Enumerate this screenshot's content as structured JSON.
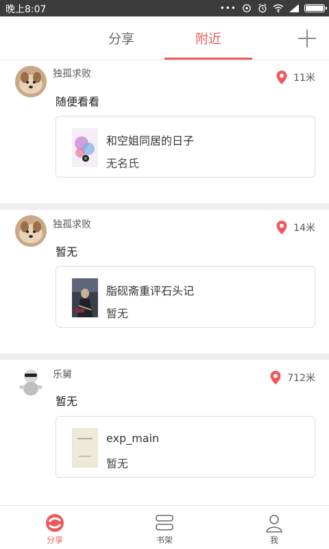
{
  "status_bar": {
    "time": "晚上8:07",
    "dots": "•••"
  },
  "tabs": [
    {
      "label": "分享",
      "active": false
    },
    {
      "label": "附近",
      "active": true
    }
  ],
  "accent_color": "#ee5a5a",
  "posts": [
    {
      "username": "独孤求败",
      "distance": "11米",
      "message": "随便看看",
      "book": {
        "title": "和空姐同居的日子",
        "author": "无名氏"
      }
    },
    {
      "username": "独孤求败",
      "distance": "14米",
      "message": "暂无",
      "book": {
        "title": "脂砚斋重评石头记",
        "author": "暂无"
      }
    },
    {
      "username": "乐舅",
      "distance": "712米",
      "message": "暂无",
      "book": {
        "title": "exp_main",
        "author": "暂无"
      }
    }
  ],
  "bottom_nav": [
    {
      "label": "分享",
      "icon": "share-icon",
      "active": true
    },
    {
      "label": "书架",
      "icon": "bookshelf-icon",
      "active": false
    },
    {
      "label": "我",
      "icon": "profile-icon",
      "active": false
    }
  ]
}
